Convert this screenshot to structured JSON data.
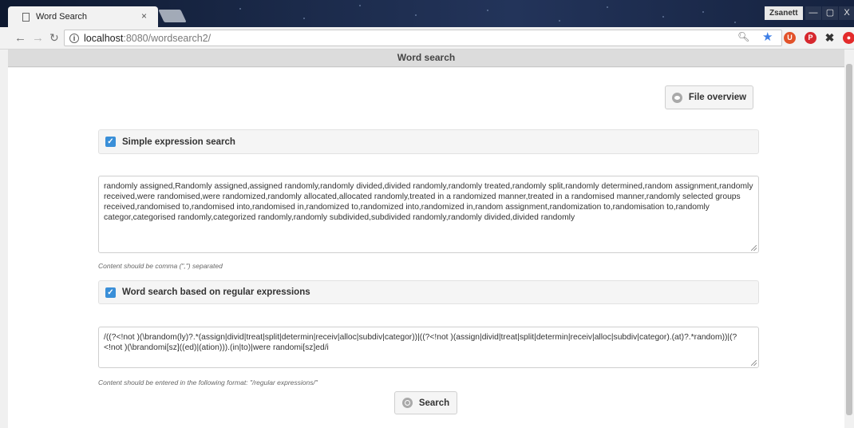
{
  "browser": {
    "tab_title": "Word Search",
    "tab_close": "×",
    "url_host": "localhost",
    "url_path": ":8080/wordsearch2/",
    "profile": "Zsanett",
    "win_min": "—",
    "win_max": "▢",
    "win_close": "X"
  },
  "page": {
    "header": "Word search",
    "file_overview_label": "File overview",
    "simple": {
      "label": "Simple expression search",
      "checked": true,
      "value": "randomly assigned,Randomly assigned,assigned randomly,randomly divided,divided randomly,randomly treated,randomly split,randomly determined,random assignment,randomly received,were randomised,were randomized,randomly allocated,allocated randomly,treated in a randomized manner,treated in a randomised manner,randomly selected groups received,randomised to,randomised into,randomised in,randomized to,randomized into,randomized in,random assignment,randomization to,randomisation to,randomly categor,categorised randomly,categorized randomly,randomly subdivided,subdivided randomly,randomly divided,divided randomly",
      "hint": "Content should be comma (\",\") separated"
    },
    "regex": {
      "label": "Word search based on regular expressions",
      "checked": true,
      "value": "/((?<!not )(\\brandom(ly)?.*(assign|divid|treat|split|determin|receiv|alloc|subdiv|categor))|((?<!not )(assign|divid|treat|split|determin|receiv|alloc|subdiv|categor).(at)?.*random))|(?<!not )(\\brandomi[sz]((ed)|(ation))).(in|to)|were randomi[sz]ed/i",
      "hint": "Content should be entered in the following format: \"/regular expressions/\""
    },
    "search_label": "Search"
  },
  "colors": {
    "accent": "#3a8fd8",
    "header_bg": "#dcdcdc"
  }
}
